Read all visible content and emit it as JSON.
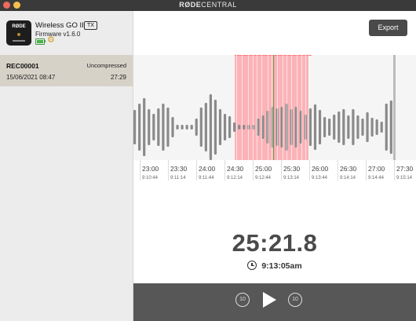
{
  "app": {
    "brand_a": "RØDE",
    "brand_b": "CENTRAL"
  },
  "device": {
    "name": "Wireless GO II",
    "badge": "TX",
    "firmware": "Firmware v1.6.0",
    "battery_level": 1.0,
    "battery_color": "#47b347",
    "settings_icon": "gear-icon"
  },
  "recording": {
    "name": "REC00001",
    "type": "Uncompressed",
    "date": "15/06/2021 08:47",
    "duration": "27:29"
  },
  "toolbar": {
    "export_label": "Export"
  },
  "timeline": {
    "ticks": [
      {
        "time": "23:00",
        "clock": "9:10:44"
      },
      {
        "time": "23:30",
        "clock": "9:11:14"
      },
      {
        "time": "24:00",
        "clock": "9:11:44"
      },
      {
        "time": "24:30",
        "clock": "9:12:14"
      },
      {
        "time": "25:00",
        "clock": "9:12:44"
      },
      {
        "time": "25:30",
        "clock": "9:13:14"
      },
      {
        "time": "26:00",
        "clock": "9:13:44"
      },
      {
        "time": "26:30",
        "clock": "9:14:14"
      },
      {
        "time": "27:00",
        "clock": "9:14:44"
      },
      {
        "time": "27:30",
        "clock": "9:15:14"
      }
    ],
    "selection_color": "#ff7b85",
    "playhead_color": "#7a9a56"
  },
  "playback": {
    "position": "25:21.8",
    "clock_time": "9:13:05am"
  },
  "transport": {
    "back_label": "10",
    "forward_label": "10"
  }
}
